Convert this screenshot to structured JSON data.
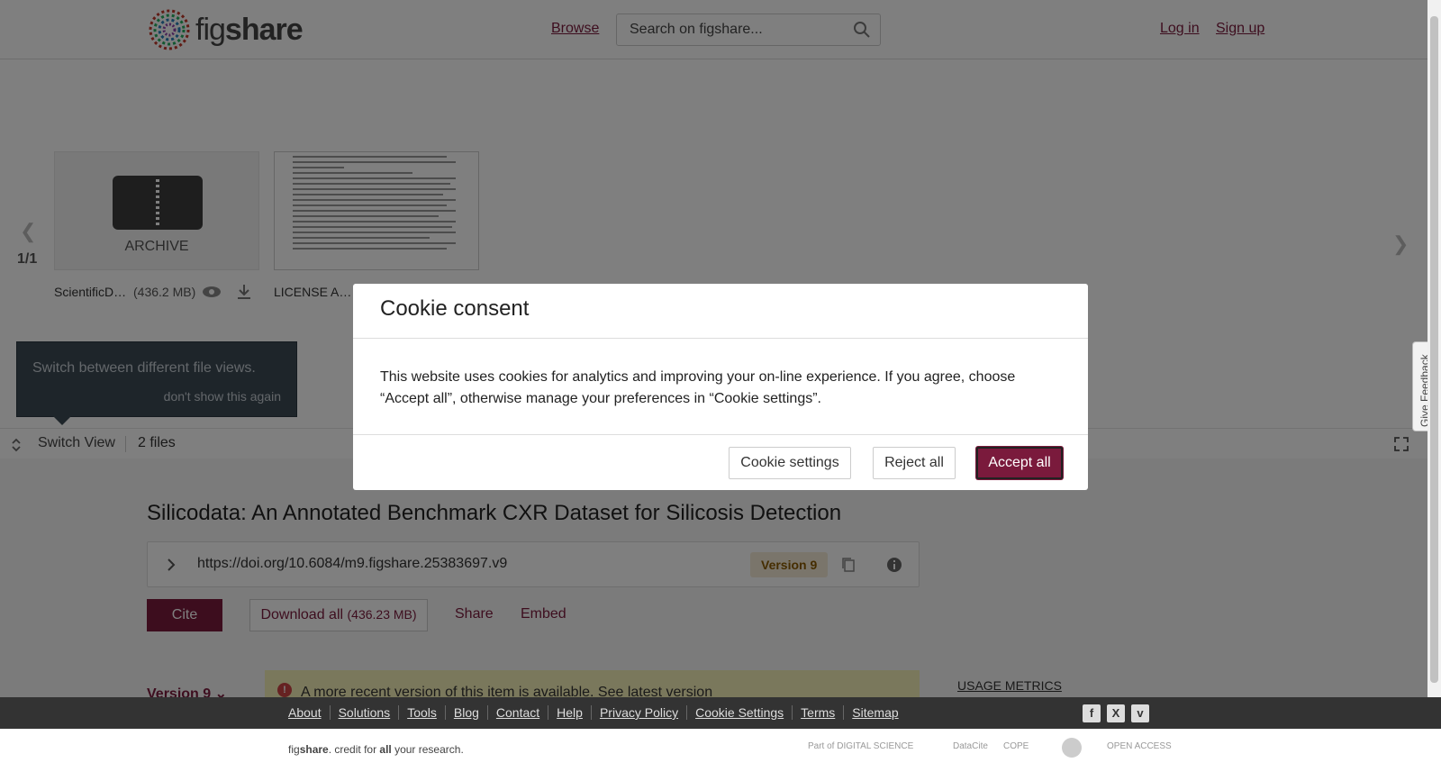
{
  "header": {
    "logo_prefix": "fig",
    "logo_suffix": "share",
    "browse": "Browse",
    "search_placeholder": "Search on figshare...",
    "login": "Log in",
    "signup": "Sign up"
  },
  "carousel": {
    "counter": "1/1",
    "tiles": [
      {
        "label": "ARCHIVE",
        "filename": "ScientificD…",
        "size": "(436.2 MB)"
      },
      {
        "label": "",
        "filename": "LICENSE A…",
        "size": ""
      }
    ]
  },
  "tooltip": {
    "message": "Switch between different file views.",
    "dismiss": "don't show this again"
  },
  "viewbar": {
    "switch_view": "Switch View",
    "files_count": "2 files"
  },
  "article": {
    "title": "Silicodata: An Annotated Benchmark CXR Dataset for Silicosis Detection",
    "doi": "https://doi.org/10.6084/m9.figshare.25383697.v9",
    "version_pill": "Version 9",
    "cite": "Cite",
    "download_label": "Download all",
    "download_size": "(436.23 MB)",
    "share": "Share",
    "embed": "Embed",
    "version_dropdown": "Version 9",
    "notice": "A more recent version of this item is available. See latest version",
    "usage_metrics": "USAGE METRICS"
  },
  "feedback": "Give Feedback",
  "modal": {
    "title": "Cookie consent",
    "body": "This website uses cookies for analytics and improving your on-line experience. If you agree, choose “Accept all”, otherwise manage your preferences in “Cookie settings”.",
    "settings": "Cookie settings",
    "reject": "Reject all",
    "accept": "Accept all"
  },
  "footer": {
    "links": [
      "About",
      "Solutions",
      "Tools",
      "Blog",
      "Contact",
      "Help",
      "Privacy Policy",
      "Cookie Settings",
      "Terms",
      "Sitemap"
    ],
    "social": [
      "f",
      "X",
      "v"
    ],
    "tagline_a": "fig",
    "tagline_b": "share",
    "tagline_c": ". credit for ",
    "tagline_d": "all",
    "tagline_e": " your research.",
    "partners": [
      "Part of DIGITAL SCIENCE",
      "DataCite",
      "COPE",
      "",
      "OPEN ACCESS"
    ]
  },
  "colors": {
    "brand": "#7a1a3c",
    "overlay": "rgba(0,0,0,0.5)",
    "notice_bg": "#f5f0b8",
    "version_pill_bg": "#f5ead6"
  }
}
